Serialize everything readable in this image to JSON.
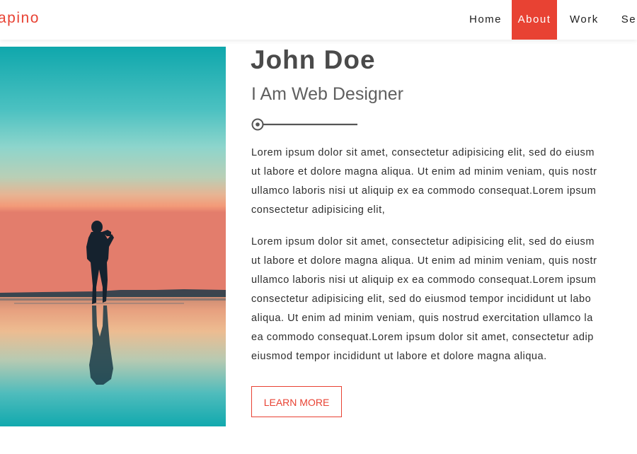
{
  "header": {
    "logo_text": "apino",
    "nav": [
      {
        "label": "Home",
        "active": false
      },
      {
        "label": "About",
        "active": true
      },
      {
        "label": "Work",
        "active": false
      },
      {
        "label": "Ser",
        "active": false
      }
    ]
  },
  "about": {
    "name": "John Doe",
    "role": "I Am Web Designer",
    "paragraphs": [
      [
        "Lorem ipsum dolor sit amet, consectetur adipisicing elit, sed do eiusm",
        "ut labore et dolore magna aliqua. Ut enim ad minim veniam, quis nostr",
        "ullamco laboris nisi ut aliquip ex ea commodo consequat.Lorem ipsum",
        "consectetur adipisicing elit,"
      ],
      [
        "Lorem ipsum dolor sit amet, consectetur adipisicing elit, sed do eiusm",
        "ut labore et dolore magna aliqua. Ut enim ad minim veniam, quis nostr",
        "ullamco laboris nisi ut aliquip ex ea commodo consequat.Lorem ipsum",
        "consectetur adipisicing elit, sed do eiusmod tempor incididunt ut labo",
        "aliqua. Ut enim ad minim veniam, quis nostrud exercitation ullamco la",
        "ea commodo consequat.Lorem ipsum dolor sit amet, consectetur adip",
        "eiusmod tempor incididunt ut labore et dolore magna aliqua."
      ]
    ],
    "button_label": "LEARN MORE"
  },
  "colors": {
    "accent": "#e84233",
    "heading": "#4a4a4a",
    "body_text": "#2e2e2e"
  }
}
